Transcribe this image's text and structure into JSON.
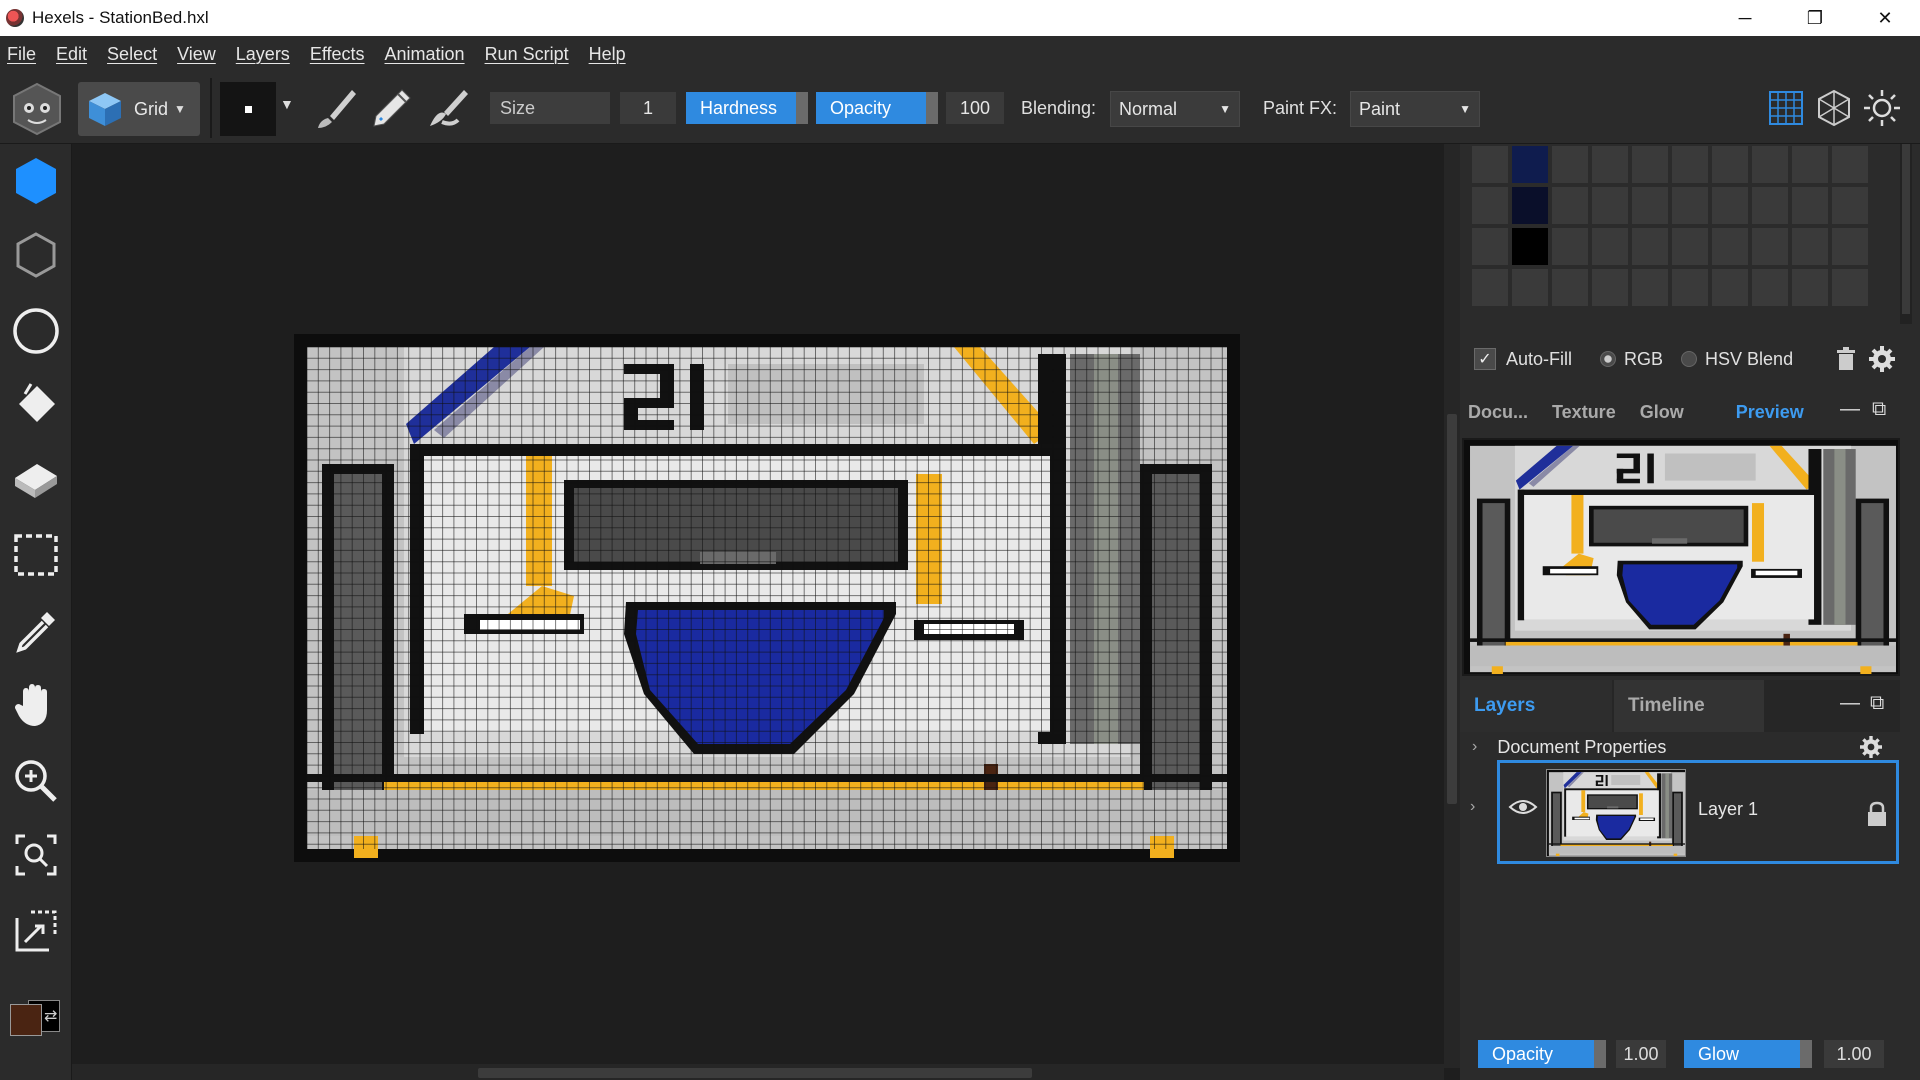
{
  "window": {
    "title": "Hexels - StationBed.hxl",
    "minimize": "─",
    "restore": "❐",
    "close": "✕"
  },
  "menu": [
    "File",
    "Edit",
    "Select",
    "View",
    "Layers",
    "Effects",
    "Animation",
    "Run Script",
    "Help"
  ],
  "toolbar": {
    "grid_label": "Grid",
    "size_label": "Size",
    "size_value": "1",
    "hardness_label": "Hardness",
    "opacity_label": "Opacity",
    "opacity_value": "100",
    "blending_label": "Blending:",
    "blending_value": "Normal",
    "paintfx_label": "Paint FX:",
    "paintfx_value": "Paint"
  },
  "colors": {
    "accent": "#2f8ae0",
    "primary_swatch": "#4a2412",
    "secondary_swatch": "#000000"
  },
  "right_panel": {
    "autofill_label": "Auto-Fill",
    "autofill_checked": true,
    "rgb_label": "RGB",
    "hsv_label": "HSV Blend",
    "tabs": [
      "Docu...",
      "Texture",
      "Glow",
      "Preview"
    ],
    "active_tab": "Preview",
    "layers_tab": "Layers",
    "timeline_tab": "Timeline",
    "document_properties": "Document Properties",
    "layer_name": "Layer 1",
    "opacity_label": "Opacity",
    "opacity_value": "1.00",
    "glow_label": "Glow",
    "glow_value": "1.00"
  },
  "canvas": {
    "number_text": "21"
  }
}
